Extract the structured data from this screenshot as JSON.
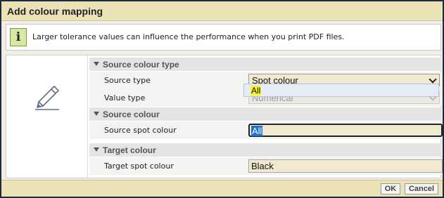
{
  "dialog": {
    "title": "Add colour mapping"
  },
  "info": {
    "icon": "info-icon",
    "text": "Larger tolerance values can influence the performance when you print PDF files."
  },
  "left_icon": "pencil-icon",
  "sections": {
    "source_type": {
      "title": "Source colour type",
      "source_type_label": "Source type",
      "source_type_value": "Spot colour",
      "value_type_label": "Value type",
      "value_type_value": "Numerical"
    },
    "source_colour": {
      "title": "Source colour",
      "spot_label": "Source spot colour",
      "spot_value": "All",
      "dropdown_option": "All"
    },
    "target_colour": {
      "title": "Target colour",
      "spot_label": "Target spot colour",
      "spot_value": "Black"
    }
  },
  "footer": {
    "ok_label": "OK",
    "cancel_label": "Cancel"
  },
  "colors": {
    "titlebar": "#ebe3b6",
    "section_header": "#e4e4e2",
    "field_bg": "#f1ead0",
    "selection": "#1e6fd6",
    "highlight": "#f7ef2a"
  }
}
